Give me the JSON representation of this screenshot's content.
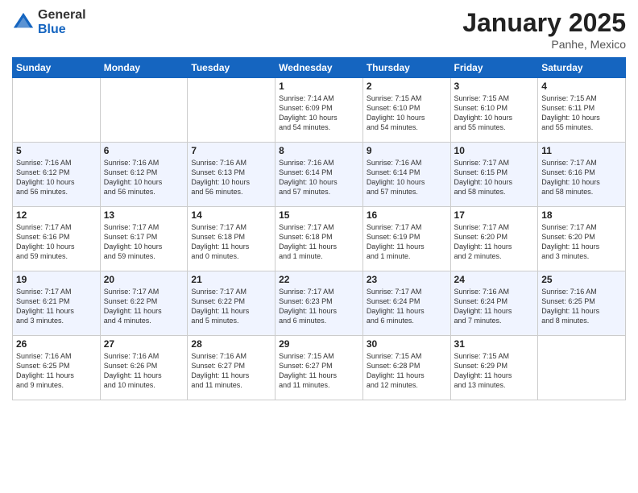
{
  "logo": {
    "general": "General",
    "blue": "Blue"
  },
  "header": {
    "month": "January 2025",
    "location": "Panhe, Mexico"
  },
  "weekdays": [
    "Sunday",
    "Monday",
    "Tuesday",
    "Wednesday",
    "Thursday",
    "Friday",
    "Saturday"
  ],
  "weeks": [
    [
      {
        "day": "",
        "info": ""
      },
      {
        "day": "",
        "info": ""
      },
      {
        "day": "",
        "info": ""
      },
      {
        "day": "1",
        "info": "Sunrise: 7:14 AM\nSunset: 6:09 PM\nDaylight: 10 hours\nand 54 minutes."
      },
      {
        "day": "2",
        "info": "Sunrise: 7:15 AM\nSunset: 6:10 PM\nDaylight: 10 hours\nand 54 minutes."
      },
      {
        "day": "3",
        "info": "Sunrise: 7:15 AM\nSunset: 6:10 PM\nDaylight: 10 hours\nand 55 minutes."
      },
      {
        "day": "4",
        "info": "Sunrise: 7:15 AM\nSunset: 6:11 PM\nDaylight: 10 hours\nand 55 minutes."
      }
    ],
    [
      {
        "day": "5",
        "info": "Sunrise: 7:16 AM\nSunset: 6:12 PM\nDaylight: 10 hours\nand 56 minutes."
      },
      {
        "day": "6",
        "info": "Sunrise: 7:16 AM\nSunset: 6:12 PM\nDaylight: 10 hours\nand 56 minutes."
      },
      {
        "day": "7",
        "info": "Sunrise: 7:16 AM\nSunset: 6:13 PM\nDaylight: 10 hours\nand 56 minutes."
      },
      {
        "day": "8",
        "info": "Sunrise: 7:16 AM\nSunset: 6:14 PM\nDaylight: 10 hours\nand 57 minutes."
      },
      {
        "day": "9",
        "info": "Sunrise: 7:16 AM\nSunset: 6:14 PM\nDaylight: 10 hours\nand 57 minutes."
      },
      {
        "day": "10",
        "info": "Sunrise: 7:17 AM\nSunset: 6:15 PM\nDaylight: 10 hours\nand 58 minutes."
      },
      {
        "day": "11",
        "info": "Sunrise: 7:17 AM\nSunset: 6:16 PM\nDaylight: 10 hours\nand 58 minutes."
      }
    ],
    [
      {
        "day": "12",
        "info": "Sunrise: 7:17 AM\nSunset: 6:16 PM\nDaylight: 10 hours\nand 59 minutes."
      },
      {
        "day": "13",
        "info": "Sunrise: 7:17 AM\nSunset: 6:17 PM\nDaylight: 10 hours\nand 59 minutes."
      },
      {
        "day": "14",
        "info": "Sunrise: 7:17 AM\nSunset: 6:18 PM\nDaylight: 11 hours\nand 0 minutes."
      },
      {
        "day": "15",
        "info": "Sunrise: 7:17 AM\nSunset: 6:18 PM\nDaylight: 11 hours\nand 1 minute."
      },
      {
        "day": "16",
        "info": "Sunrise: 7:17 AM\nSunset: 6:19 PM\nDaylight: 11 hours\nand 1 minute."
      },
      {
        "day": "17",
        "info": "Sunrise: 7:17 AM\nSunset: 6:20 PM\nDaylight: 11 hours\nand 2 minutes."
      },
      {
        "day": "18",
        "info": "Sunrise: 7:17 AM\nSunset: 6:20 PM\nDaylight: 11 hours\nand 3 minutes."
      }
    ],
    [
      {
        "day": "19",
        "info": "Sunrise: 7:17 AM\nSunset: 6:21 PM\nDaylight: 11 hours\nand 3 minutes."
      },
      {
        "day": "20",
        "info": "Sunrise: 7:17 AM\nSunset: 6:22 PM\nDaylight: 11 hours\nand 4 minutes."
      },
      {
        "day": "21",
        "info": "Sunrise: 7:17 AM\nSunset: 6:22 PM\nDaylight: 11 hours\nand 5 minutes."
      },
      {
        "day": "22",
        "info": "Sunrise: 7:17 AM\nSunset: 6:23 PM\nDaylight: 11 hours\nand 6 minutes."
      },
      {
        "day": "23",
        "info": "Sunrise: 7:17 AM\nSunset: 6:24 PM\nDaylight: 11 hours\nand 6 minutes."
      },
      {
        "day": "24",
        "info": "Sunrise: 7:16 AM\nSunset: 6:24 PM\nDaylight: 11 hours\nand 7 minutes."
      },
      {
        "day": "25",
        "info": "Sunrise: 7:16 AM\nSunset: 6:25 PM\nDaylight: 11 hours\nand 8 minutes."
      }
    ],
    [
      {
        "day": "26",
        "info": "Sunrise: 7:16 AM\nSunset: 6:25 PM\nDaylight: 11 hours\nand 9 minutes."
      },
      {
        "day": "27",
        "info": "Sunrise: 7:16 AM\nSunset: 6:26 PM\nDaylight: 11 hours\nand 10 minutes."
      },
      {
        "day": "28",
        "info": "Sunrise: 7:16 AM\nSunset: 6:27 PM\nDaylight: 11 hours\nand 11 minutes."
      },
      {
        "day": "29",
        "info": "Sunrise: 7:15 AM\nSunset: 6:27 PM\nDaylight: 11 hours\nand 11 minutes."
      },
      {
        "day": "30",
        "info": "Sunrise: 7:15 AM\nSunset: 6:28 PM\nDaylight: 11 hours\nand 12 minutes."
      },
      {
        "day": "31",
        "info": "Sunrise: 7:15 AM\nSunset: 6:29 PM\nDaylight: 11 hours\nand 13 minutes."
      },
      {
        "day": "",
        "info": ""
      }
    ]
  ]
}
